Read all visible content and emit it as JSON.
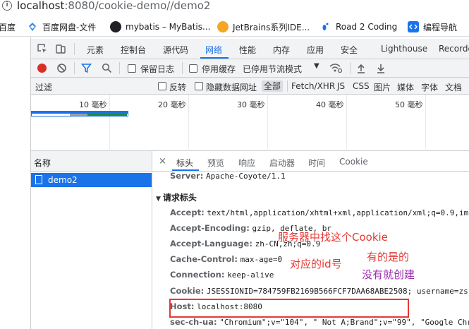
{
  "address_bar": {
    "host": "localhost",
    "rest": ":8080/cookie-demo//demo2"
  },
  "bookmarks": [
    {
      "label": "百度",
      "color": "#ffffff"
    },
    {
      "label": "百度网盘-文件",
      "color": "#2d8cf0"
    },
    {
      "label": "mybatis – MyBatis...",
      "color": "#202124"
    },
    {
      "label": "JetBrains系列IDE...",
      "color": "#f5a623"
    },
    {
      "label": "Road 2 Coding",
      "color": "#1a73e8"
    },
    {
      "label": "编程导航",
      "color": "#1a73e8"
    }
  ],
  "devtools": {
    "tabs": [
      "元素",
      "控制台",
      "源代码",
      "网络",
      "性能",
      "内存",
      "应用",
      "安全",
      "Lighthouse",
      "Recorde"
    ],
    "active_tab": "网络",
    "toolbar": {
      "preserve_log": "保留日志",
      "disable_cache": "停用缓存",
      "throttle": "已停用节流模式"
    },
    "filter": {
      "placeholder": "过滤",
      "invert": "反转",
      "hide_data_urls": "隐藏数据网址",
      "types": [
        "全部",
        "Fetch/XHR",
        "JS",
        "CSS",
        "图片",
        "媒体",
        "字体",
        "文档"
      ]
    },
    "timeline_ticks": [
      "10 毫秒",
      "20 毫秒",
      "30 毫秒",
      "40 毫秒",
      "50 毫秒"
    ],
    "name_header": "名称",
    "requests": [
      {
        "name": "demo2"
      }
    ],
    "detail_tabs": [
      "标头",
      "预览",
      "响应",
      "启动器",
      "时间",
      "Cookie"
    ],
    "detail_active": "标头",
    "server_row": {
      "key": "Server:",
      "value": "Apache-Coyote/1.1"
    },
    "section_title": "请求标头",
    "request_headers": [
      {
        "key": "Accept:",
        "value": "text/html,application/xhtml+xml,application/xml;q=0.9,ima"
      },
      {
        "key": "Accept-Encoding:",
        "value": "gzip, deflate, br"
      },
      {
        "key": "Accept-Language:",
        "value": "zh-CN,zh;q=0.9"
      },
      {
        "key": "Cache-Control:",
        "value": "max-age=0"
      },
      {
        "key": "Connection:",
        "value": "keep-alive"
      },
      {
        "key": "Cookie:",
        "value": "JSESSIONID=784759FB2169B566FCF7DAA68ABE2508; username=zs"
      },
      {
        "key": "Host:",
        "value": "localhost:8080"
      },
      {
        "key": "sec-ch-ua:",
        "value": "\"Chromium\";v=\"104\", \" Not A;Brand\";v=\"99\", \"Google Chro"
      }
    ]
  },
  "annotations": {
    "line1": "服务器中找这个Cookie",
    "line2": "有的是的",
    "line3": "对应的id号",
    "line4": "没有就创建",
    "color_red": "#e53935",
    "color_purple": "#9c27b0"
  }
}
